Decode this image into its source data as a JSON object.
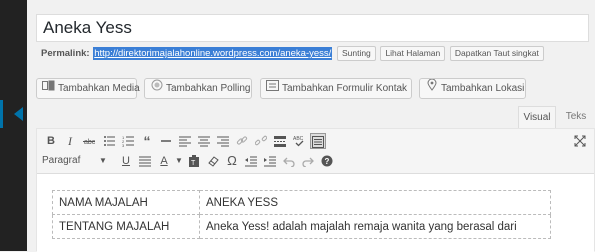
{
  "post": {
    "title": "Aneka Yess"
  },
  "permalink": {
    "label": "Permalink:",
    "url": "http://direktorimajalahonline.wordpress.com/aneka-yess/",
    "buttons": [
      "Sunting",
      "Lihat Halaman",
      "Dapatkan Taut singkat"
    ]
  },
  "media_buttons": [
    {
      "label": "Tambahkan Media",
      "icon": "add-media-icon"
    },
    {
      "label": "Tambahkan Polling",
      "icon": "poll-icon"
    },
    {
      "label": "Tambahkan Formulir Kontak",
      "icon": "contact-form-icon"
    },
    {
      "label": "Tambahkan Lokasi",
      "icon": "location-pin-icon"
    }
  ],
  "editor_tabs": {
    "visual": "Visual",
    "text": "Teks"
  },
  "toolbar": {
    "bold": "B",
    "italic": "I",
    "format_select": "Paragraf",
    "underline": "U",
    "text_color": "A",
    "omega": "Ω"
  },
  "content_table": {
    "rows": [
      [
        "NAMA MAJALAH",
        "ANEKA YESS"
      ],
      [
        "TENTANG MAJALAH",
        "Aneka Yess! adalah majalah remaja wanita yang berasal dari"
      ]
    ]
  },
  "colors": {
    "accent": "#0073aa",
    "permalink_highlight": "#3b7fd6",
    "admin_bar": "#222222"
  }
}
